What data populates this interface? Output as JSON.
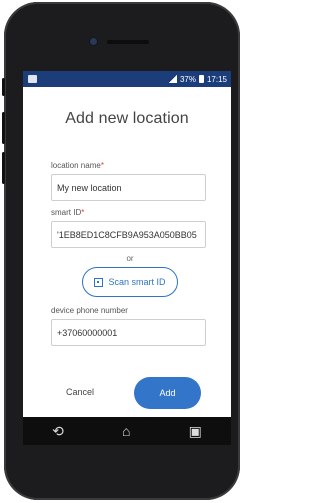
{
  "status": {
    "battery": "37%",
    "time": "17:15"
  },
  "page": {
    "title": "Add new location"
  },
  "form": {
    "location_name_label": "location name",
    "location_name_value": "My new location",
    "smart_id_label": "smart ID",
    "smart_id_value": "'1EB8ED1C8CFB9A953A050BB05",
    "or_text": "or",
    "scan_button_label": "Scan smart ID",
    "phone_label": "device phone number",
    "phone_value": "+37060000001"
  },
  "actions": {
    "cancel_label": "Cancel",
    "add_label": "Add"
  },
  "icons": {
    "back": "back-icon",
    "home": "home-icon",
    "recent": "recent-apps-icon",
    "qr": "qr-code-icon"
  },
  "colors": {
    "status_bar": "#1b3d7a",
    "accent": "#3275c9",
    "required": "#e53935"
  }
}
